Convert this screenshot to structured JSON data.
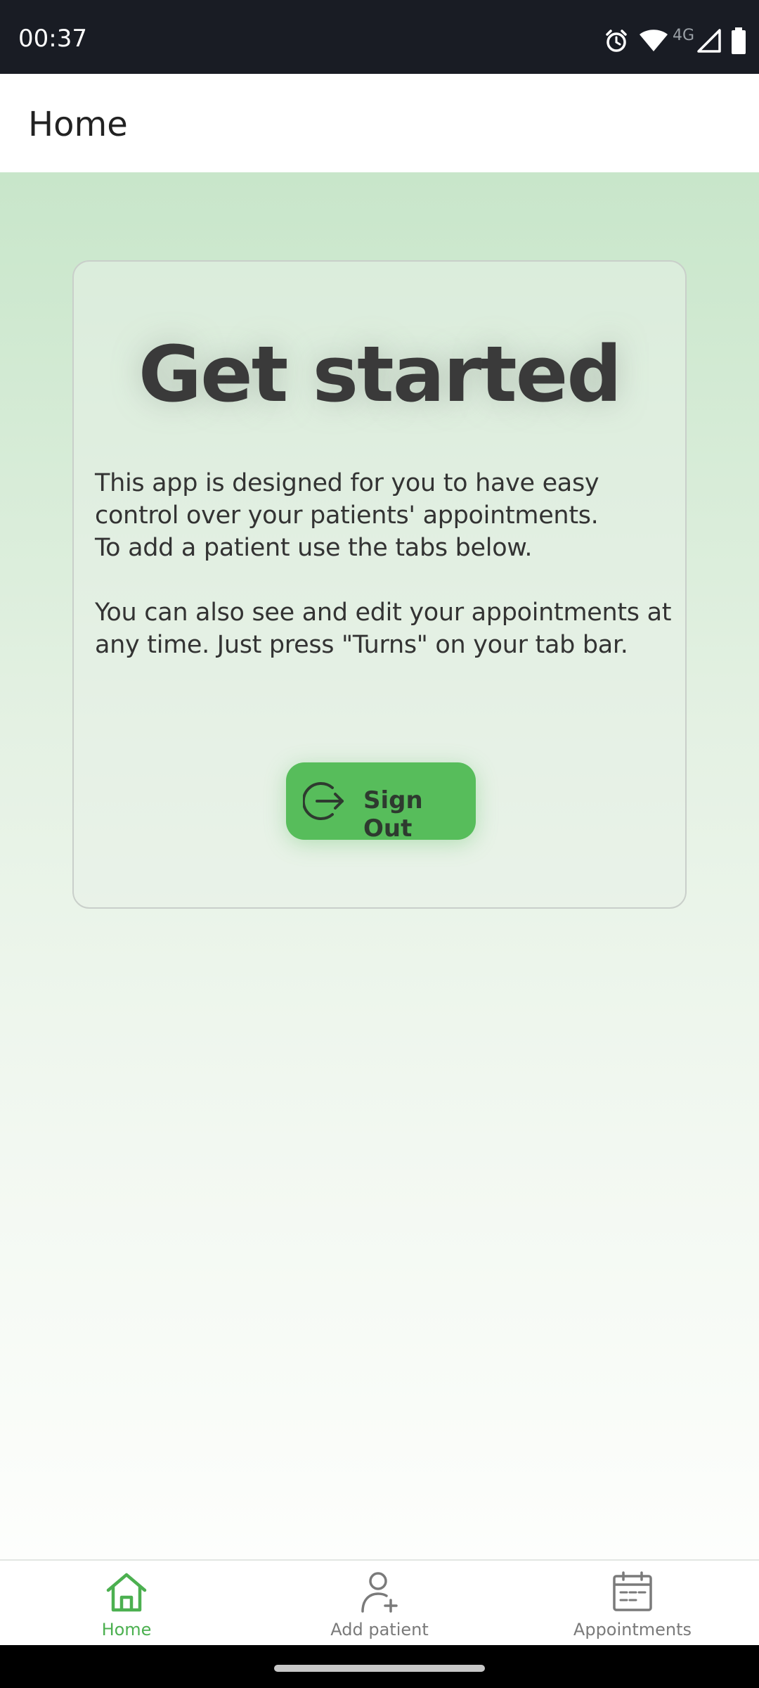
{
  "status_bar": {
    "time": "00:37",
    "network_label": "4G",
    "icons": [
      "alarm-icon",
      "wifi-icon",
      "cell-signal-icon",
      "battery-icon"
    ]
  },
  "header": {
    "title": "Home"
  },
  "card": {
    "title": "Get started",
    "paragraphs": [
      "This app is designed for you to have easy control over your patients' appointments.",
      "To add a patient use the tabs below.",
      "You can also see and edit your appointments at any time. Just press \"Turns\" on your tab bar."
    ],
    "sign_out_label": "Sign Out"
  },
  "tabs": [
    {
      "label": "Home",
      "icon": "home-icon",
      "active": true
    },
    {
      "label": "Add patient",
      "icon": "add-user-icon",
      "active": false
    },
    {
      "label": "Appointments",
      "icon": "calendar-icon",
      "active": false
    }
  ],
  "colors": {
    "accent": "#57bd5b",
    "active_tab": "#4cb050",
    "inactive_tab": "#7a7a7a",
    "status_bar_bg": "#191c24"
  }
}
